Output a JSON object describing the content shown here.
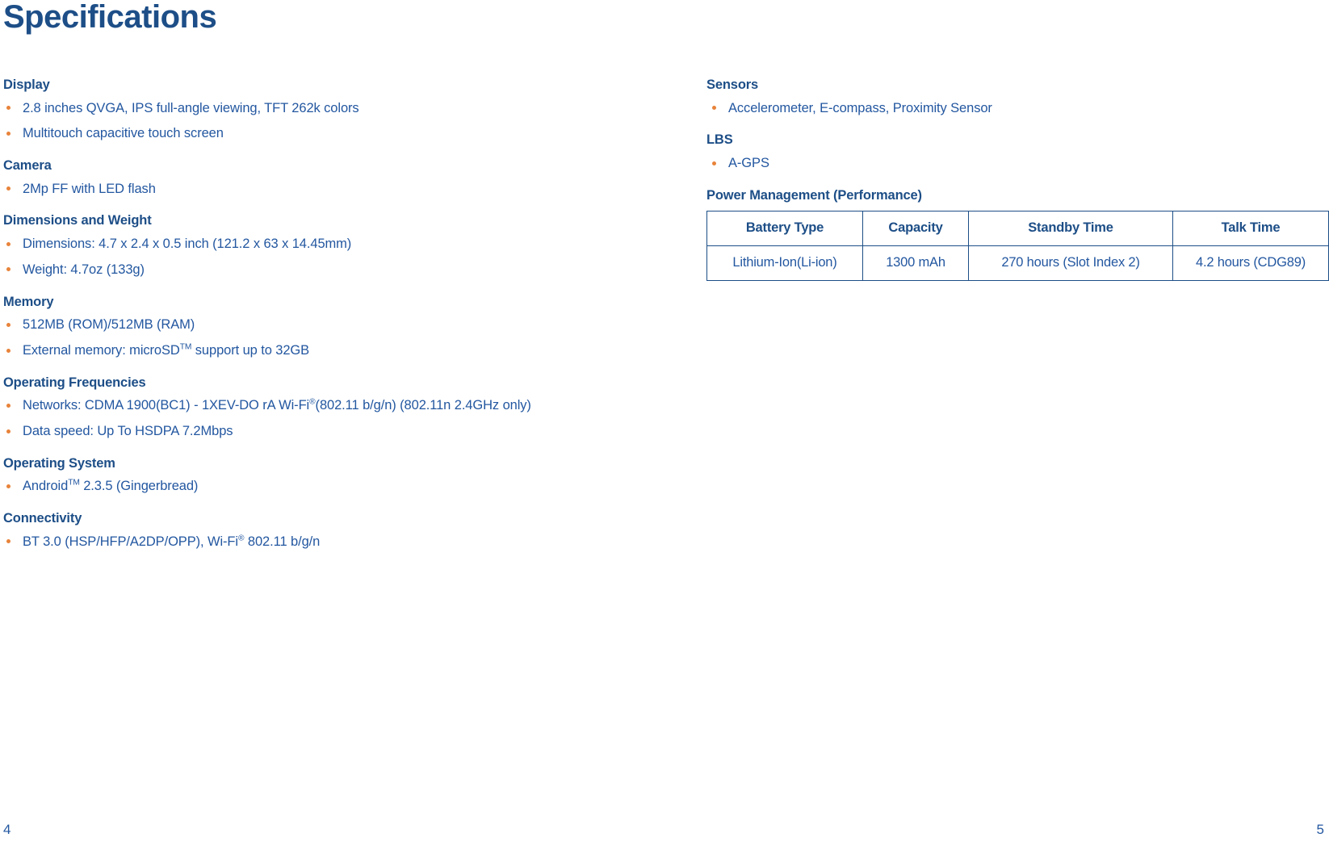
{
  "document": {
    "title": "Specifications",
    "accent_color": "#1d4e87",
    "body_text_color": "#2357a0",
    "bullet_color": "#e8833a"
  },
  "left_column": {
    "sections": [
      {
        "heading": "Display",
        "items": [
          "2.8 inches QVGA, IPS full-angle viewing, TFT 262k colors",
          "Multitouch capacitive touch screen"
        ]
      },
      {
        "heading": "Camera",
        "items": [
          "2Mp FF with LED flash"
        ]
      },
      {
        "heading": "Dimensions and Weight",
        "items": [
          "Dimensions: 4.7 x 2.4 x 0.5 inch (121.2 x 63 x 14.45mm)",
          "Weight: 4.7oz (133g)"
        ]
      },
      {
        "heading": "Memory",
        "items": [
          "512MB (ROM)/512MB (RAM)",
          "External memory: microSD™ support up to 32GB"
        ],
        "items_parts": [
          null,
          {
            "pre": "External memory: microSD",
            "sup": "TM",
            "post": " support up to 32GB"
          }
        ]
      },
      {
        "heading": "Operating Frequencies",
        "items": [
          "Networks: CDMA 1900(BC1) - 1XEV-DO rA Wi-Fi®(802.11 b/g/n) (802.11n 2.4GHz only)",
          "Data speed: Up To HSDPA 7.2Mbps"
        ],
        "items_parts": [
          {
            "pre": "Networks: CDMA 1900(BC1) - 1XEV-DO rA Wi-Fi",
            "sup": "®",
            "post": "(802.11 b/g/n) (802.11n 2.4GHz only)"
          },
          null
        ]
      },
      {
        "heading": "Operating System",
        "items": [
          "Android™ 2.3.5 (Gingerbread)"
        ],
        "items_parts": [
          {
            "pre": "Android",
            "sup": "TM",
            "post": " 2.3.5 (Gingerbread)"
          }
        ]
      },
      {
        "heading": "Connectivity",
        "items": [
          "BT 3.0 (HSP/HFP/A2DP/OPP), Wi-Fi® 802.11 b/g/n"
        ],
        "items_parts": [
          {
            "pre": "BT 3.0 (HSP/HFP/A2DP/OPP), Wi-Fi",
            "sup": "®",
            "post": " 802.11 b/g/n"
          }
        ]
      }
    ]
  },
  "right_column": {
    "sections": [
      {
        "heading": "Sensors",
        "items": [
          "Accelerometer, E-compass, Proximity Sensor"
        ]
      },
      {
        "heading": "LBS",
        "items": [
          "A-GPS"
        ]
      }
    ],
    "power_management": {
      "heading": "Power Management (Performance)",
      "table": {
        "columns": [
          "Battery Type",
          "Capacity",
          "Standby Time",
          "Talk Time"
        ],
        "rows": [
          [
            "Lithium-Ion(Li-ion)",
            "1300 mAh",
            "270 hours (Slot Index 2)",
            "4.2 hours (CDG89)"
          ]
        ]
      }
    }
  },
  "footer": {
    "page_left": "4",
    "page_right": "5"
  }
}
